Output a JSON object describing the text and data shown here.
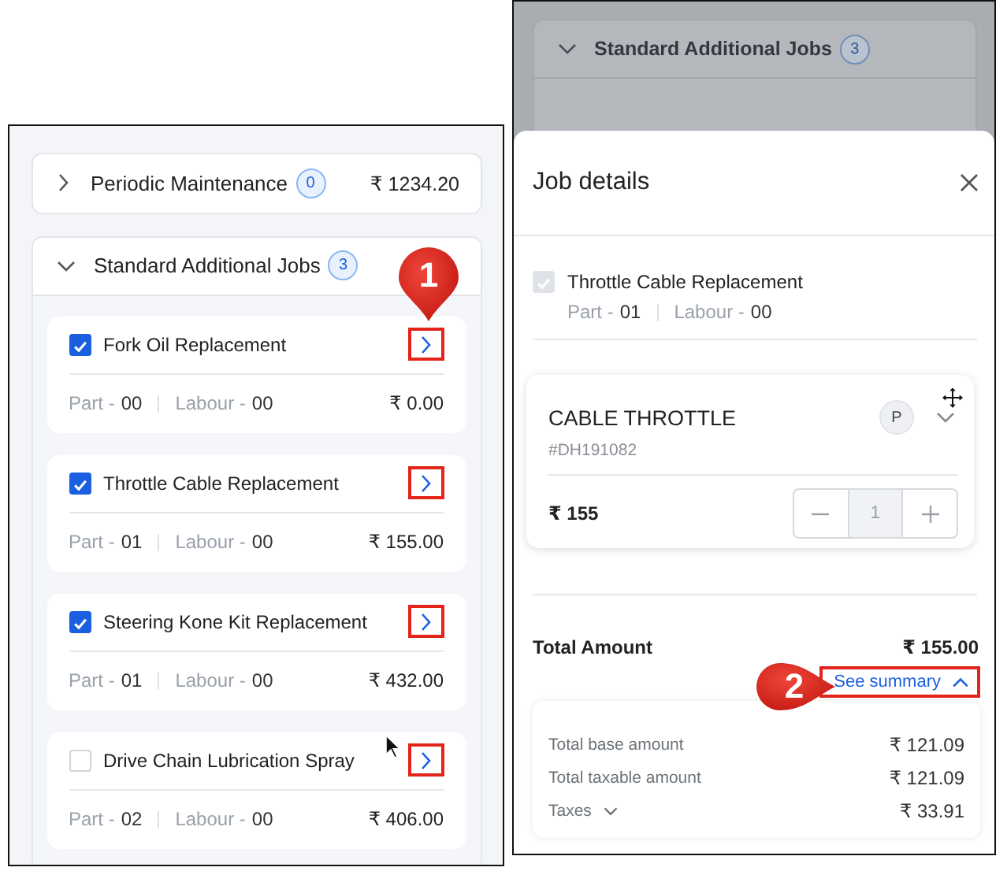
{
  "left_panel": {
    "sections": [
      {
        "title": "Periodic Maintenance",
        "count": "0",
        "amount": "₹ 1234.20",
        "expanded": false
      },
      {
        "title": "Standard Additional Jobs",
        "count": "3",
        "expanded": true,
        "jobs": [
          {
            "name": "Fork Oil Replacement",
            "checked": true,
            "part_label": "Part -",
            "part": "00",
            "labour_label": "Labour -",
            "labour": "00",
            "amount": "₹ 0.00",
            "highlighted": true
          },
          {
            "name": "Throttle Cable Replacement",
            "checked": true,
            "part_label": "Part -",
            "part": "01",
            "labour_label": "Labour -",
            "labour": "00",
            "amount": "₹ 155.00",
            "highlighted": true
          },
          {
            "name": "Steering Kone Kit Replacement",
            "checked": true,
            "part_label": "Part -",
            "part": "01",
            "labour_label": "Labour -",
            "labour": "00",
            "amount": "₹ 432.00",
            "highlighted": true
          },
          {
            "name": "Drive Chain Lubrication Spray",
            "checked": false,
            "part_label": "Part -",
            "part": "02",
            "labour_label": "Labour -",
            "labour": "00",
            "amount": "₹ 406.00",
            "highlighted": true
          }
        ]
      }
    ]
  },
  "right_panel": {
    "background_section": {
      "title": "Standard Additional Jobs",
      "count": "3",
      "expanded": true
    },
    "job_details": {
      "title": "Job details",
      "job": {
        "name": "Throttle Cable Replacement",
        "checked": true,
        "disabled": true,
        "part_label": "Part -",
        "part": "01",
        "labour_label": "Labour -",
        "labour": "00"
      },
      "part_card": {
        "name": "CABLE THROTTLE",
        "code": "#DH191082",
        "badge": "P",
        "price": "₹ 155",
        "quantity": "1"
      },
      "total": {
        "label": "Total Amount",
        "amount": "₹ 155.00"
      },
      "summary_link": {
        "label": "See summary",
        "expanded": true,
        "highlighted": true
      },
      "summary_rows": [
        {
          "label": "Total base amount",
          "value": "₹ 121.09",
          "expandable": false
        },
        {
          "label": "Total taxable amount",
          "value": "₹ 121.09",
          "expandable": false
        },
        {
          "label": "Taxes",
          "value": "₹ 33.91",
          "expandable": true
        }
      ]
    }
  },
  "callouts": [
    {
      "number": "1"
    },
    {
      "number": "2"
    }
  ]
}
